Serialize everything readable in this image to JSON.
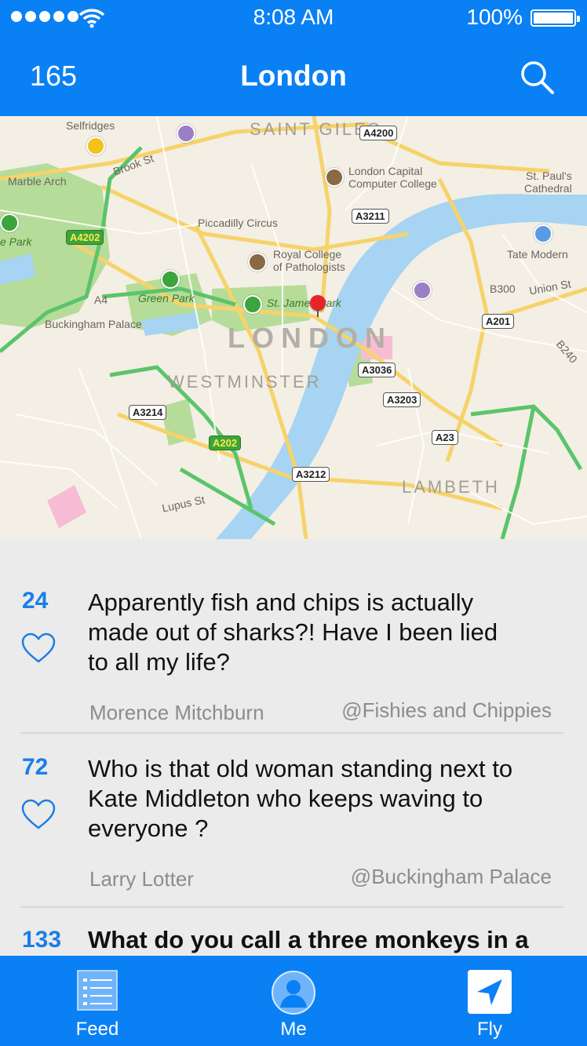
{
  "status_bar": {
    "time": "8:08 AM",
    "battery_percent": "100%",
    "signal_bars": 5
  },
  "header": {
    "count": "165",
    "title": "London"
  },
  "map": {
    "labels": {
      "selfridges": "Selfridges",
      "saint_giles": "SAINT GILES",
      "brook_st": "Brook St",
      "marble_arch": "Marble Arch",
      "london_capital": "London Capital",
      "computer_college": "Computer College",
      "st_pauls": "St. Paul's",
      "cathedral": "Cathedral",
      "piccadilly": "Piccadilly Circus",
      "royal_college": "Royal College",
      "pathologists": "of Pathologists",
      "park": "e Park",
      "tate": "Tate Modern",
      "green_park": "Green Park",
      "st_james": "St. James Park",
      "union_st": "Union St",
      "buckingham": "Buckingham Palace",
      "london": "LONDON",
      "westminster": "WESTMINSTER",
      "lambeth": "LAMBETH",
      "lupus_st": "Lupus St",
      "b300": "B300",
      "b240": "B240",
      "a4": "A4"
    },
    "road_shields": {
      "a4200": "A4200",
      "a3211": "A3211",
      "a4202": "A4202",
      "a201": "A201",
      "a3036": "A3036",
      "a3203": "A3203",
      "a3214": "A3214",
      "a202": "A202",
      "a23": "A23",
      "a3212": "A3212"
    }
  },
  "feed": {
    "posts": [
      {
        "votes": "24",
        "lines": [
          "Apparently fish and chips is actually",
          "made out of sharks?! Have I been lied",
          "to all my life?"
        ],
        "author": "Morence Mitchburn",
        "place": "@Fishies and Chippies"
      },
      {
        "votes": "72",
        "lines": [
          "Who is that old woman standing next to",
          "Kate Middleton who keeps waving to",
          "everyone ?"
        ],
        "author": "Larry Lotter",
        "place": "@Buckingham Palace"
      },
      {
        "votes": "133",
        "lines": [
          "What do you call a three monkeys in a"
        ]
      }
    ]
  },
  "tabbar": {
    "tabs": [
      {
        "label": "Feed",
        "icon": "list-icon"
      },
      {
        "label": "Me",
        "icon": "person-icon"
      },
      {
        "label": "Fly",
        "icon": "location-arrow-icon"
      }
    ]
  },
  "colors": {
    "accent": "#0a80f5",
    "vote": "#1a7ee6",
    "water": "#a6d4f2",
    "park": "#b6dc9a"
  }
}
